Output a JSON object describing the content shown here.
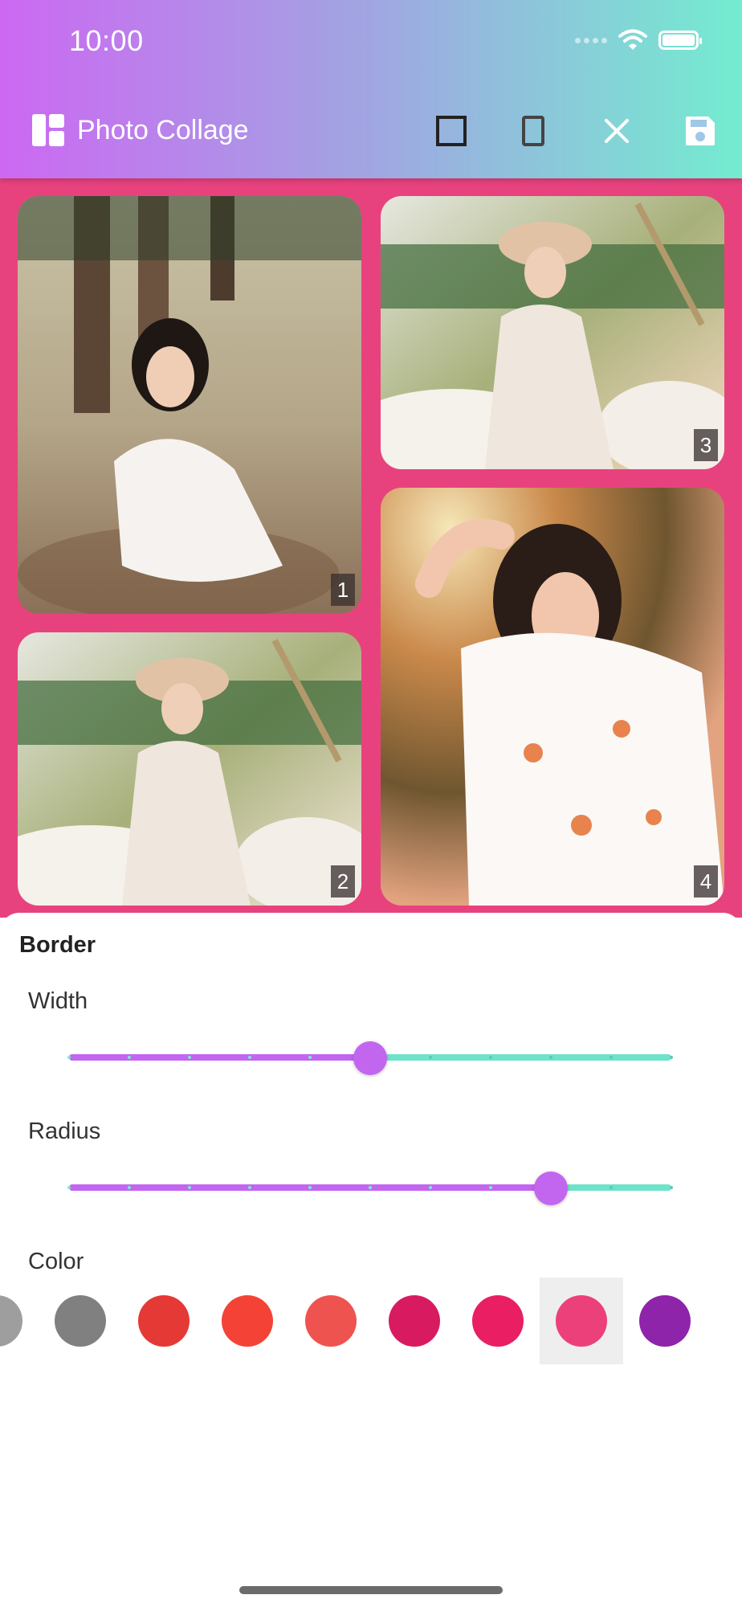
{
  "status_bar": {
    "time": "10:00"
  },
  "app_bar": {
    "title": "Photo Collage",
    "actions": [
      "square-frame-icon",
      "portrait-frame-icon",
      "close-icon",
      "save-icon"
    ]
  },
  "collage": {
    "background_color": "#e8427e",
    "photos": [
      {
        "badge": "1"
      },
      {
        "badge": "2"
      },
      {
        "badge": "3"
      },
      {
        "badge": "4"
      }
    ]
  },
  "border_panel": {
    "title": "Border",
    "width": {
      "label": "Width",
      "value_fraction": 0.5,
      "steps": 10
    },
    "radius": {
      "label": "Radius",
      "value_fraction": 0.8,
      "steps": 10
    },
    "color": {
      "label": "Color",
      "swatches": [
        "#9e9e9e",
        "#808080",
        "#e53935",
        "#f44336",
        "#ef5350",
        "#d81b60",
        "#e91e63",
        "#ec407a",
        "#8e24aa"
      ],
      "selected_index": 7
    }
  },
  "theme": {
    "accent_purple": "#c266f0",
    "accent_teal": "#6fe3c9"
  }
}
